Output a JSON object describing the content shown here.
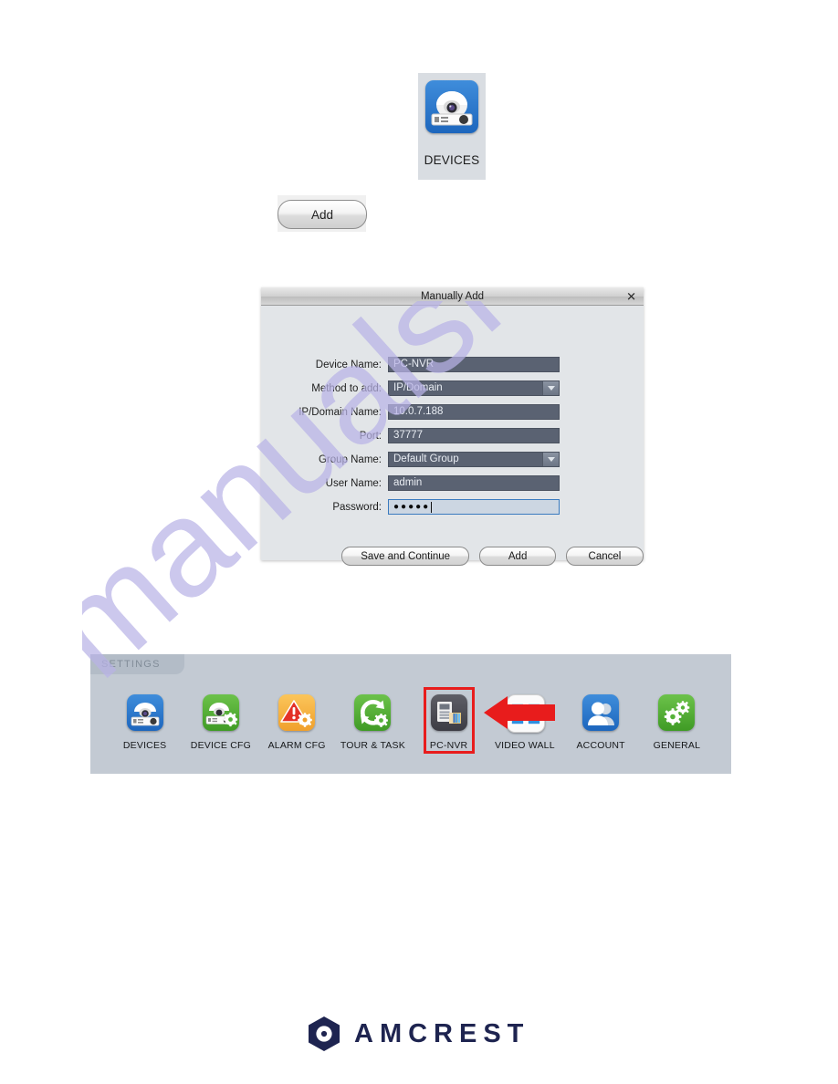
{
  "top_icon": {
    "label": "DEVICES",
    "icon": "dome-camera-icon"
  },
  "add_button": {
    "label": "Add"
  },
  "dialog": {
    "title": "Manually Add",
    "close_label": "✕",
    "fields": [
      {
        "label": "Device Name:",
        "value": "PC-NVR",
        "type": "text"
      },
      {
        "label": "Method to add:",
        "value": "IP/Domain",
        "type": "select"
      },
      {
        "label": "IP/Domain Name:",
        "value": "10.0.7.188",
        "type": "text"
      },
      {
        "label": "Port:",
        "value": "37777",
        "type": "text"
      },
      {
        "label": "Group Name:",
        "value": "Default Group",
        "type": "select"
      },
      {
        "label": "User Name:",
        "value": "admin",
        "type": "text"
      },
      {
        "label": "Password:",
        "value": "●●●●●",
        "type": "password"
      }
    ],
    "buttons": {
      "save_continue": "Save and Continue",
      "add": "Add",
      "cancel": "Cancel"
    }
  },
  "settings_panel": {
    "tab_label": "SETTINGS",
    "items": [
      {
        "label": "DEVICES",
        "icon": "dome-camera-icon",
        "color": "#2f7fd0",
        "selected": false
      },
      {
        "label": "DEVICE CFG",
        "icon": "camera-gear-icon",
        "color": "#56b23a",
        "selected": false
      },
      {
        "label": "ALARM CFG",
        "icon": "warning-triangle-icon",
        "color": "#f5b342",
        "selected": false
      },
      {
        "label": "TOUR & TASK",
        "icon": "refresh-gear-icon",
        "color": "#56b23a",
        "selected": false
      },
      {
        "label": "PC-NVR",
        "icon": "pc-nvr-icon",
        "color": "#4c4c55",
        "selected": true
      },
      {
        "label": "VIDEO WALL",
        "icon": "video-wall-icon",
        "color": "#ffffff",
        "selected": false
      },
      {
        "label": "ACCOUNT",
        "icon": "user-account-icon",
        "color": "#2f7fd0",
        "selected": false
      },
      {
        "label": "GENERAL",
        "icon": "gears-icon",
        "color": "#56b23a",
        "selected": false
      }
    ],
    "selection_color": "#e81c1c",
    "pointer_color": "#e81c1c"
  },
  "watermark": {
    "text": "manualshive.com",
    "color": "#b9b3e6"
  },
  "footer": {
    "brand": "AMCREST",
    "brand_color": "#1e2450"
  }
}
